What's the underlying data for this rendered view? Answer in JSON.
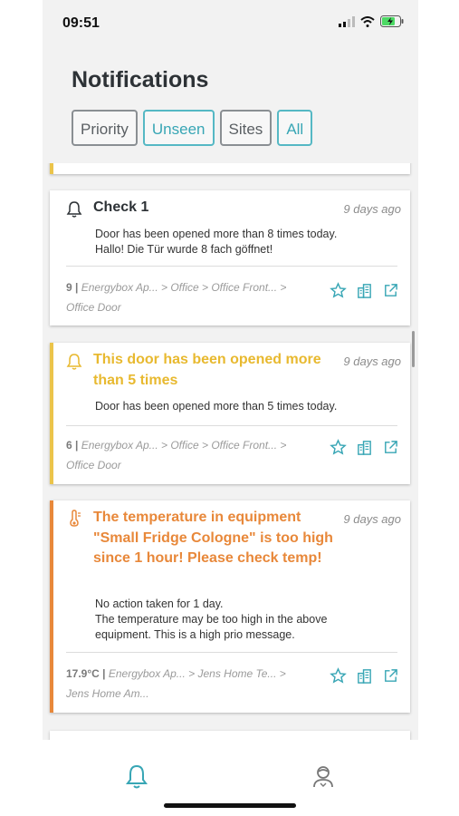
{
  "status": {
    "time": "09:51"
  },
  "header": {
    "title": "Notifications"
  },
  "filters": [
    {
      "label": "Priority",
      "active": false
    },
    {
      "label": "Unseen",
      "active": true
    },
    {
      "label": "Sites",
      "active": false
    },
    {
      "label": "All",
      "active": true
    }
  ],
  "cards": [
    {
      "title": "Check 1",
      "ago": "9 days ago",
      "body_line1": "Door has been opened more than 8 times today.",
      "body_line2": "Hallo! Die Tür wurde 8 fach göffnet!",
      "value": "9 |",
      "path": "Energybox Ap... > Office > Office Front... >",
      "path2": "Office Door",
      "color": "#2d3236",
      "bar_color": "#ffffff"
    },
    {
      "title": "This door has been opened more than 5 times",
      "ago": "9 days ago",
      "body_line1": "Door has been opened more than 5 times today.",
      "value": "6 |",
      "path": "Energybox Ap... > Office > Office Front... >",
      "path2": "Office Door",
      "color": "#e8b92f",
      "bar_color": "#ebc44a"
    },
    {
      "title": "The temperature in equipment \"Small Fridge Cologne\" is too high since 1 hour! Please check temp!",
      "ago": "9 days ago",
      "body_line1": "No action taken for 1 day.",
      "body_line2": "The temperature may be too high in the above equipment. This is a high prio message.",
      "value": "17.9°C |",
      "path": "Energybox Ap... > Jens Home Te... >",
      "path2": "Jens Home Am...",
      "color": "#e8883a",
      "bar_color": "#e8883a"
    }
  ],
  "icons": {
    "bell": "bell-icon",
    "thermometer": "thermometer-icon",
    "star": "star-icon",
    "building": "building-icon",
    "external": "external-link-icon",
    "profile": "profile-icon"
  },
  "colors": {
    "accent": "#38a6b5",
    "warning": "#e8b92f",
    "alert": "#e8883a"
  }
}
